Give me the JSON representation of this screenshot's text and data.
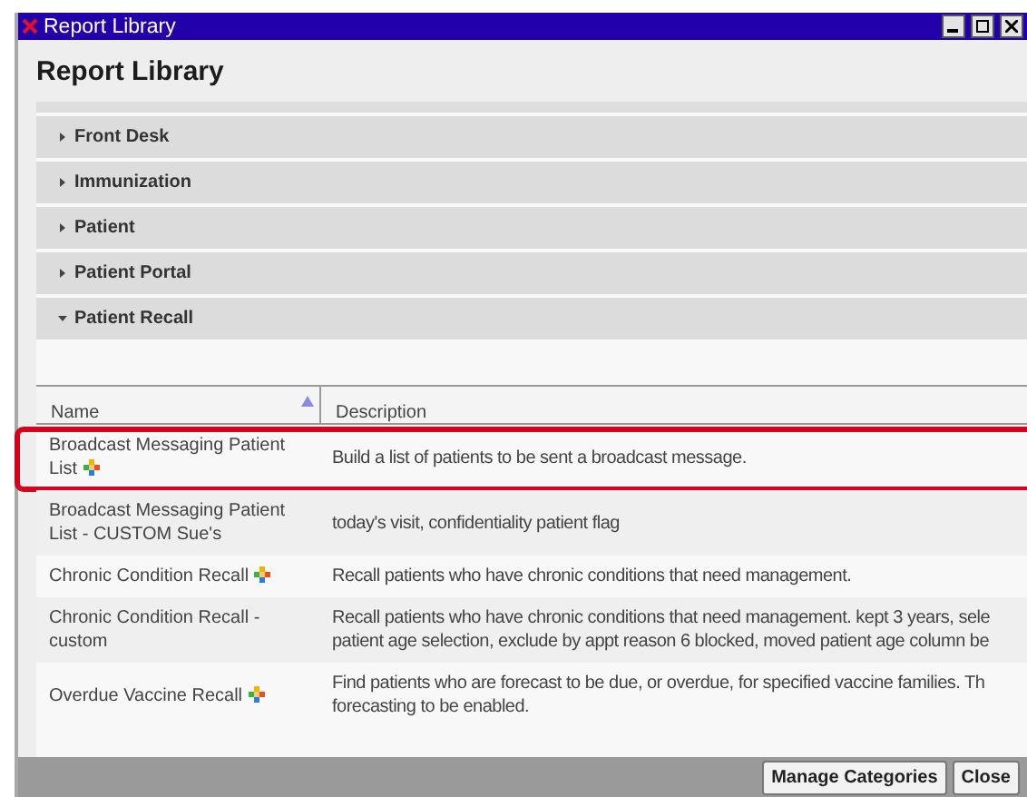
{
  "window": {
    "title": "Report Library"
  },
  "heading": "Report Library",
  "categories": [
    {
      "label": "Front Desk",
      "expanded": false
    },
    {
      "label": "Immunization",
      "expanded": false
    },
    {
      "label": "Patient",
      "expanded": false
    },
    {
      "label": "Patient Portal",
      "expanded": false
    },
    {
      "label": "Patient Recall",
      "expanded": true
    }
  ],
  "table": {
    "columns": [
      {
        "label": "Name",
        "sorted": true
      },
      {
        "label": "Description",
        "sorted": false
      }
    ],
    "rows": [
      {
        "name": "Broadcast Messaging Patient List",
        "plus_badge": true,
        "highlighted": true,
        "description": [
          "Build a list of patients to be sent a broadcast message."
        ]
      },
      {
        "name": "Broadcast Messaging Patient List - CUSTOM Sue's",
        "plus_badge": false,
        "highlighted": false,
        "description": [
          "today's visit, confidentiality patient flag"
        ]
      },
      {
        "name": "Chronic Condition Recall",
        "plus_badge": true,
        "highlighted": false,
        "description": [
          "Recall patients who have chronic conditions that need management."
        ]
      },
      {
        "name": "Chronic Condition Recall - custom",
        "plus_badge": false,
        "highlighted": false,
        "description": [
          "Recall patients who have chronic conditions that need management. kept 3 years, sele",
          "patient age selection, exclude by appt reason 6 blocked, moved patient age column be"
        ]
      },
      {
        "name": "Overdue Vaccine Recall",
        "plus_badge": true,
        "highlighted": false,
        "description": [
          "Find patients who are forecast to be due, or overdue, for specified vaccine families. Th",
          "forecasting to be enabled."
        ]
      }
    ]
  },
  "buttons": [
    "Manage Categories",
    "Close"
  ]
}
